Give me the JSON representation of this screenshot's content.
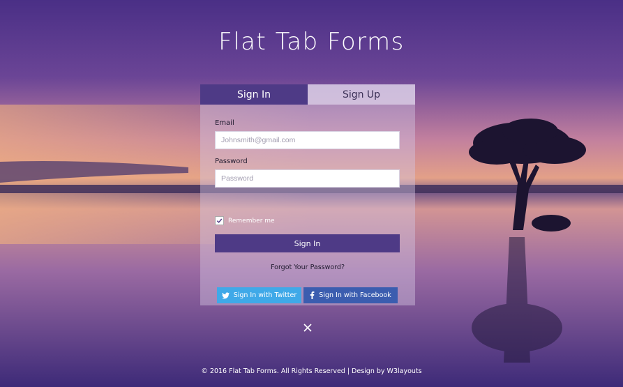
{
  "page": {
    "title": "Flat Tab Forms"
  },
  "tabs": [
    {
      "label": "Sign In",
      "active": true
    },
    {
      "label": "Sign Up",
      "active": false
    }
  ],
  "form": {
    "email_label": "Email",
    "email_placeholder": "Johnsmith@gmail.com",
    "password_label": "Password",
    "password_placeholder": "Password",
    "remember_label": "Remember me",
    "remember_checked": true,
    "signin_label": "Sign In",
    "forgot_label": "Forgot Your Password?",
    "twitter_label": "Sign In with Twitter",
    "facebook_label": "Sign In with Facebook"
  },
  "footer": {
    "text": "© 2016 Flat Tab Forms. All Rights Reserved | Design by W3layouts"
  },
  "colors": {
    "primary": "#4e3a86",
    "twitter": "#3fa9e8",
    "facebook": "#3b5daf"
  },
  "icons": {
    "close": "close-icon",
    "twitter": "twitter-icon",
    "facebook": "facebook-icon",
    "check": "checkmark-icon"
  }
}
